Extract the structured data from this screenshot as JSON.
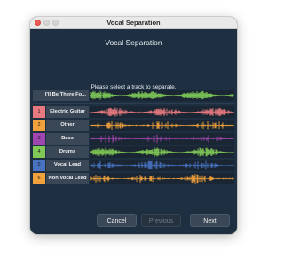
{
  "window": {
    "title": "Vocal Separation"
  },
  "main": {
    "heading": "Vocal Separation",
    "instruction": "Please select a track to separate."
  },
  "mix_track": {
    "label": "I'll Be There Fo...",
    "color": "#7dc857"
  },
  "tracks": [
    {
      "number": "1",
      "label": "Electric Guitar",
      "color": "#e87a7f",
      "num_bg": "#e87a7f",
      "density": 0.85,
      "icon": "waveform"
    },
    {
      "number": "2",
      "label": "Other",
      "color": "#f2a23c",
      "num_bg": "#f2a23c",
      "density": 0.35,
      "icon": "waveform"
    },
    {
      "number": "3",
      "label": "Bass",
      "color": "#a046b0",
      "num_bg": "#a046b0",
      "density": 0.25,
      "icon": "waveform"
    },
    {
      "number": "4",
      "label": "Drums",
      "color": "#80c956",
      "num_bg": "#80c956",
      "density": 0.9,
      "icon": "waveform"
    },
    {
      "number": "5",
      "label": "Vocal Lead",
      "color": "#4873c1",
      "num_bg": "#4873c1",
      "density": 0.6,
      "icon": "waveform"
    },
    {
      "number": "6",
      "label": "Non Vocal Lead",
      "color": "#f2a23c",
      "num_bg": "#f2a23c",
      "density": 0.55,
      "icon": "waveform"
    }
  ],
  "buttons": {
    "cancel": "Cancel",
    "previous": "Previous",
    "next": "Next"
  }
}
